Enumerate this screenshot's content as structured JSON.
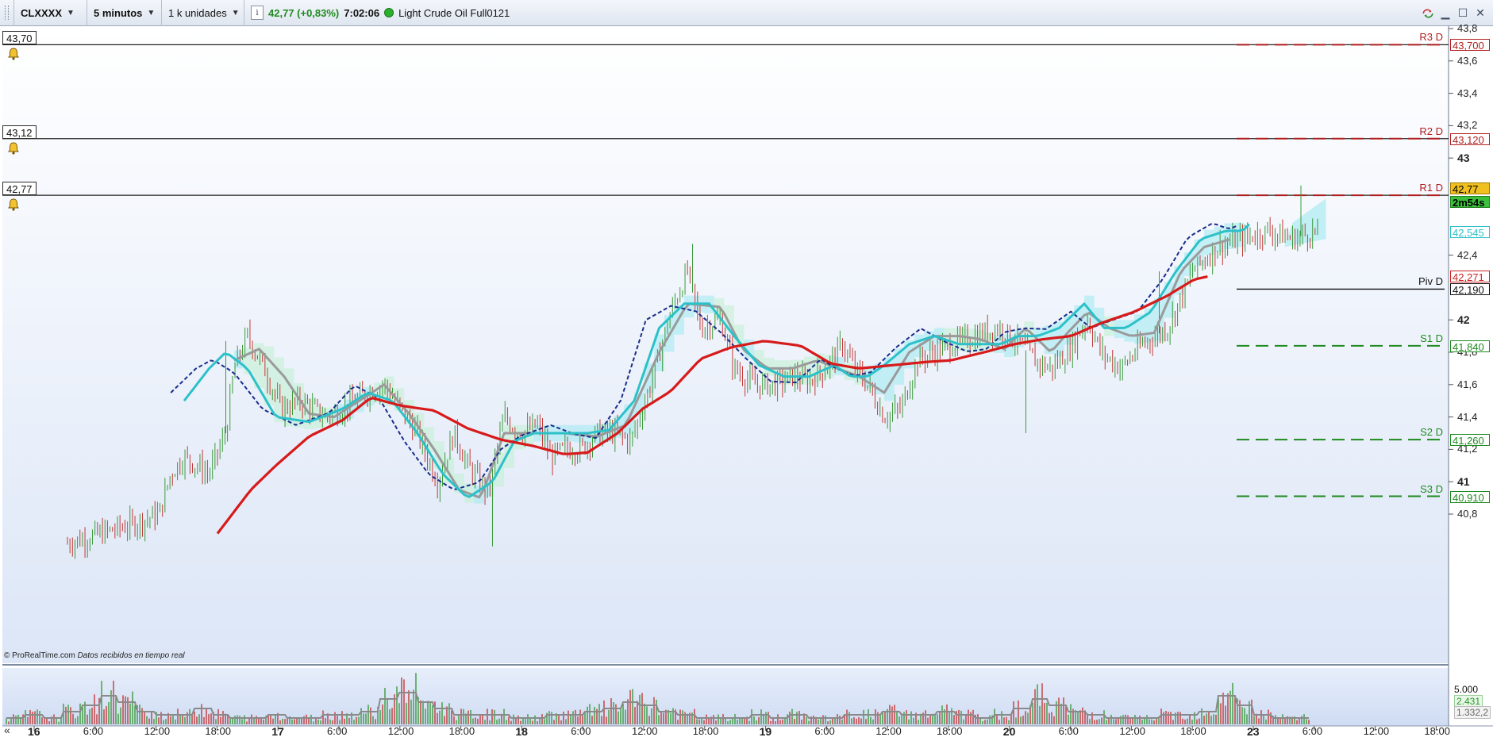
{
  "toolbar": {
    "symbol": "CLXXXX",
    "timeframe": "5 minutos",
    "units": "1 k unidades",
    "info": "i",
    "price_change": "42,77 (+0,83%)",
    "time": "7:02:06",
    "instrument_name": "Light Crude Oil Full0121"
  },
  "icons": {
    "sync": "sync-icon",
    "minimize": "minimize-icon",
    "maximize": "maximize-icon",
    "close": "close-icon",
    "bell": "bell-icon"
  },
  "alert_levels": [
    {
      "label": "43,70",
      "value": 43.7
    },
    {
      "label": "43,12",
      "value": 43.12
    },
    {
      "label": "42,77",
      "value": 42.77
    }
  ],
  "pivot_levels": [
    {
      "name": "R3 D",
      "tag": "43,700",
      "value": 43.7,
      "kind": "res"
    },
    {
      "name": "R2 D",
      "tag": "43,120",
      "value": 43.12,
      "kind": "res"
    },
    {
      "name": "R1 D",
      "tag": "",
      "value": 42.77,
      "kind": "res"
    },
    {
      "name": "Piv D",
      "tag": "42,190",
      "value": 42.19,
      "kind": "piv"
    },
    {
      "name": "S1 D",
      "tag": "41,840",
      "value": 41.84,
      "kind": "sup"
    },
    {
      "name": "S2 D",
      "tag": "41,260",
      "value": 41.26,
      "kind": "sup"
    },
    {
      "name": "S3 D",
      "tag": "40,910",
      "value": 40.91,
      "kind": "sup"
    }
  ],
  "price_axis": [
    {
      "label": "43,8",
      "value": 43.8,
      "bold": false
    },
    {
      "label": "43,6",
      "value": 43.6,
      "bold": false
    },
    {
      "label": "43,4",
      "value": 43.4,
      "bold": false
    },
    {
      "label": "43,2",
      "value": 43.2,
      "bold": false
    },
    {
      "label": "43",
      "value": 43.0,
      "bold": true
    },
    {
      "label": "42,4",
      "value": 42.4,
      "bold": false
    },
    {
      "label": "42",
      "value": 42.0,
      "bold": true
    },
    {
      "label": "41,8",
      "value": 41.8,
      "bold": false
    },
    {
      "label": "41,6",
      "value": 41.6,
      "bold": false
    },
    {
      "label": "41,4",
      "value": 41.4,
      "bold": false
    },
    {
      "label": "41,2",
      "value": 41.2,
      "bold": false
    },
    {
      "label": "41",
      "value": 41.0,
      "bold": true
    },
    {
      "label": "40,8",
      "value": 40.8,
      "bold": false
    }
  ],
  "price_tags": {
    "current": "42,77",
    "countdown": "2m54s",
    "ma_cyan": "42,545",
    "ma_red": "42,271"
  },
  "time_axis": [
    {
      "label": "16",
      "day": true
    },
    {
      "label": "6:00",
      "day": false
    },
    {
      "label": "12:00",
      "day": false
    },
    {
      "label": "18:00",
      "day": false
    },
    {
      "label": "17",
      "day": true
    },
    {
      "label": "6:00",
      "day": false
    },
    {
      "label": "12:00",
      "day": false
    },
    {
      "label": "18:00",
      "day": false
    },
    {
      "label": "18",
      "day": true
    },
    {
      "label": "6:00",
      "day": false
    },
    {
      "label": "12:00",
      "day": false
    },
    {
      "label": "18:00",
      "day": false
    },
    {
      "label": "19",
      "day": true
    },
    {
      "label": "6:00",
      "day": false
    },
    {
      "label": "12:00",
      "day": false
    },
    {
      "label": "18:00",
      "day": false
    },
    {
      "label": "20",
      "day": true
    },
    {
      "label": "6:00",
      "day": false
    },
    {
      "label": "12:00",
      "day": false
    },
    {
      "label": "18:00",
      "day": false
    },
    {
      "label": "23",
      "day": true
    },
    {
      "label": "6:00",
      "day": false
    },
    {
      "label": "12:00",
      "day": false
    },
    {
      "label": "18:00",
      "day": false
    }
  ],
  "volume_axis": {
    "top": "5.000",
    "current": "2.431",
    "avg": "1.332,2"
  },
  "copyright": {
    "brand": "© ProRealTime.com",
    "note": "Datos recibidos en tiempo real"
  },
  "nav_left": "«",
  "colors": {
    "bull": "#3c9a3c",
    "bear": "#c23a3a",
    "ma_red": "#d71a1a",
    "ma_cyan": "#2cc1c8",
    "ma_gray": "#9a9a9a",
    "ma_dash": "#1a2d8a",
    "resistance": "#b01e1e",
    "support": "#1e8a1e"
  },
  "series": {
    "close_path": [
      [
        0,
        40.62
      ],
      [
        20,
        40.68
      ],
      [
        40,
        40.74
      ],
      [
        55,
        40.8
      ],
      [
        62,
        41.05
      ],
      [
        70,
        41.15
      ],
      [
        85,
        41.05
      ],
      [
        95,
        41.3
      ],
      [
        100,
        41.7
      ],
      [
        108,
        41.9
      ],
      [
        118,
        41.7
      ],
      [
        128,
        41.45
      ],
      [
        140,
        41.5
      ],
      [
        155,
        41.4
      ],
      [
        165,
        41.45
      ],
      [
        180,
        41.55
      ],
      [
        190,
        41.6
      ],
      [
        200,
        41.45
      ],
      [
        210,
        41.3
      ],
      [
        222,
        41.0
      ],
      [
        232,
        41.3
      ],
      [
        240,
        41.1
      ],
      [
        252,
        40.93
      ],
      [
        262,
        41.4
      ],
      [
        272,
        41.3
      ],
      [
        282,
        41.35
      ],
      [
        290,
        41.15
      ],
      [
        298,
        41.2
      ],
      [
        308,
        41.2
      ],
      [
        318,
        41.3
      ],
      [
        328,
        41.3
      ],
      [
        338,
        41.25
      ],
      [
        350,
        41.6
      ],
      [
        362,
        42.05
      ],
      [
        372,
        42.3
      ],
      [
        380,
        41.95
      ],
      [
        392,
        42.0
      ],
      [
        400,
        41.7
      ],
      [
        412,
        41.6
      ],
      [
        425,
        41.6
      ],
      [
        435,
        41.65
      ],
      [
        445,
        41.62
      ],
      [
        455,
        41.7
      ],
      [
        465,
        41.85
      ],
      [
        472,
        41.7
      ],
      [
        480,
        41.6
      ],
      [
        490,
        41.4
      ],
      [
        500,
        41.45
      ],
      [
        510,
        41.75
      ],
      [
        520,
        41.8
      ],
      [
        532,
        41.85
      ],
      [
        545,
        41.9
      ],
      [
        558,
        41.95
      ],
      [
        572,
        41.85
      ],
      [
        580,
        41.75
      ],
      [
        590,
        41.7
      ],
      [
        600,
        41.8
      ],
      [
        612,
        42.0
      ],
      [
        620,
        41.8
      ],
      [
        632,
        41.7
      ],
      [
        645,
        41.85
      ],
      [
        660,
        41.95
      ],
      [
        675,
        42.3
      ],
      [
        690,
        42.45
      ],
      [
        705,
        42.5
      ],
      [
        720,
        42.55
      ],
      [
        735,
        42.5
      ],
      [
        750,
        42.55
      ]
    ],
    "cyan_path": [
      [
        70,
        41.5
      ],
      [
        85,
        41.7
      ],
      [
        95,
        41.8
      ],
      [
        108,
        41.7
      ],
      [
        125,
        41.4
      ],
      [
        145,
        41.37
      ],
      [
        165,
        41.45
      ],
      [
        180,
        41.55
      ],
      [
        195,
        41.5
      ],
      [
        210,
        41.3
      ],
      [
        225,
        41.05
      ],
      [
        240,
        40.9
      ],
      [
        255,
        41.0
      ],
      [
        268,
        41.25
      ],
      [
        280,
        41.3
      ],
      [
        298,
        41.3
      ],
      [
        312,
        41.3
      ],
      [
        325,
        41.32
      ],
      [
        340,
        41.5
      ],
      [
        355,
        41.95
      ],
      [
        370,
        42.1
      ],
      [
        385,
        42.1
      ],
      [
        400,
        41.9
      ],
      [
        415,
        41.72
      ],
      [
        430,
        41.65
      ],
      [
        445,
        41.65
      ],
      [
        460,
        41.72
      ],
      [
        470,
        41.65
      ],
      [
        480,
        41.65
      ],
      [
        490,
        41.72
      ],
      [
        505,
        41.85
      ],
      [
        520,
        41.9
      ],
      [
        535,
        41.85
      ],
      [
        548,
        41.85
      ],
      [
        560,
        41.85
      ],
      [
        570,
        41.9
      ],
      [
        582,
        41.9
      ],
      [
        595,
        41.95
      ],
      [
        610,
        42.1
      ],
      [
        622,
        41.95
      ],
      [
        635,
        41.95
      ],
      [
        650,
        42.05
      ],
      [
        665,
        42.3
      ],
      [
        680,
        42.5
      ],
      [
        695,
        42.55
      ],
      [
        705,
        42.55
      ],
      [
        710,
        42.6
      ]
    ],
    "gray_path": [
      [
        100,
        41.75
      ],
      [
        115,
        41.82
      ],
      [
        130,
        41.65
      ],
      [
        145,
        41.42
      ],
      [
        160,
        41.4
      ],
      [
        175,
        41.5
      ],
      [
        190,
        41.6
      ],
      [
        205,
        41.42
      ],
      [
        220,
        41.2
      ],
      [
        235,
        40.95
      ],
      [
        248,
        40.9
      ],
      [
        262,
        41.3
      ],
      [
        280,
        41.3
      ],
      [
        298,
        41.3
      ],
      [
        318,
        41.28
      ],
      [
        335,
        41.35
      ],
      [
        355,
        41.8
      ],
      [
        372,
        42.1
      ],
      [
        392,
        42.08
      ],
      [
        405,
        41.82
      ],
      [
        420,
        41.7
      ],
      [
        435,
        41.7
      ],
      [
        450,
        41.75
      ],
      [
        462,
        41.7
      ],
      [
        475,
        41.65
      ],
      [
        490,
        41.55
      ],
      [
        505,
        41.8
      ],
      [
        520,
        41.9
      ],
      [
        535,
        41.9
      ],
      [
        548,
        41.88
      ],
      [
        562,
        41.82
      ],
      [
        575,
        41.95
      ],
      [
        590,
        41.8
      ],
      [
        600,
        41.92
      ],
      [
        612,
        42.05
      ],
      [
        625,
        41.95
      ],
      [
        638,
        41.9
      ],
      [
        652,
        41.92
      ],
      [
        668,
        42.3
      ],
      [
        682,
        42.45
      ],
      [
        698,
        42.5
      ]
    ],
    "red_path": [
      [
        90,
        40.68
      ],
      [
        110,
        40.95
      ],
      [
        125,
        41.1
      ],
      [
        145,
        41.28
      ],
      [
        165,
        41.38
      ],
      [
        182,
        41.52
      ],
      [
        200,
        41.47
      ],
      [
        220,
        41.44
      ],
      [
        240,
        41.33
      ],
      [
        260,
        41.26
      ],
      [
        280,
        41.22
      ],
      [
        298,
        41.17
      ],
      [
        312,
        41.18
      ],
      [
        330,
        41.3
      ],
      [
        345,
        41.45
      ],
      [
        362,
        41.56
      ],
      [
        380,
        41.76
      ],
      [
        398,
        41.83
      ],
      [
        418,
        41.87
      ],
      [
        440,
        41.84
      ],
      [
        458,
        41.73
      ],
      [
        475,
        41.7
      ],
      [
        495,
        41.72
      ],
      [
        515,
        41.74
      ],
      [
        530,
        41.75
      ],
      [
        550,
        41.8
      ],
      [
        568,
        41.85
      ],
      [
        585,
        41.88
      ],
      [
        602,
        41.9
      ],
      [
        620,
        41.98
      ],
      [
        640,
        42.05
      ],
      [
        660,
        42.15
      ],
      [
        676,
        42.25
      ],
      [
        685,
        42.27
      ]
    ],
    "volume_profile": [
      0.2,
      0.3,
      0.2,
      0.4,
      0.6,
      0.9,
      0.7,
      0.4,
      0.3,
      0.3,
      0.5,
      0.3,
      0.2,
      0.2,
      0.3,
      0.2,
      0.2,
      0.3,
      0.3,
      0.4,
      0.8,
      1.0,
      0.7,
      0.5,
      0.3,
      0.3,
      0.3,
      0.2,
      0.2,
      0.3,
      0.3,
      0.4,
      0.5,
      0.7,
      0.6,
      0.4,
      0.3,
      0.2,
      0.2,
      0.2,
      0.3,
      0.2,
      0.3,
      0.2,
      0.2,
      0.3,
      0.3,
      0.4,
      0.3,
      0.3,
      0.4,
      0.3,
      0.2,
      0.3,
      0.5,
      0.8,
      0.6,
      0.4,
      0.3,
      0.2,
      0.2,
      0.2,
      0.3,
      0.3,
      0.4,
      0.9,
      0.6,
      0.3,
      0.2,
      0.2
    ]
  }
}
